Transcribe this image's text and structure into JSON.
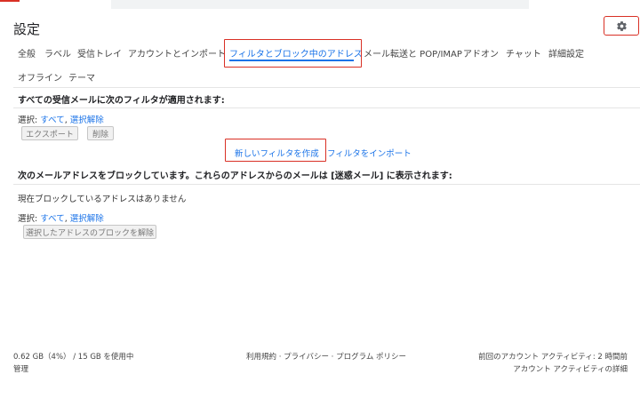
{
  "header": {
    "title": "設定",
    "settings_icon": "gear-icon"
  },
  "tabs": [
    {
      "label": "全般"
    },
    {
      "label": "ラベル"
    },
    {
      "label": "受信トレイ"
    },
    {
      "label": "アカウントとインポート"
    },
    {
      "label": "フィルタとブロック中のアドレス",
      "active": true
    },
    {
      "label": "メール転送と POP/IMAP"
    },
    {
      "label": "アドオン"
    },
    {
      "label": "チャット"
    },
    {
      "label": "詳細設定"
    },
    {
      "label": "オフライン"
    },
    {
      "label": "テーマ"
    }
  ],
  "filters": {
    "heading": "すべての受信メールに次のフィルタが適用されます:",
    "select_label": "選択:",
    "select_all": "すべて",
    "separator": ",",
    "deselect": "選択解除",
    "export_button": "エクスポート",
    "delete_button": "削除",
    "create_filter": "新しいフィルタを作成",
    "import_filters": "フィルタをインポート"
  },
  "blocked": {
    "heading": "次のメールアドレスをブロックしています。これらのアドレスからのメールは [迷惑メール] に表示されます:",
    "empty_text": "現在ブロックしているアドレスはありません",
    "select_label": "選択:",
    "select_all": "すべて",
    "separator": ",",
    "deselect": "選択解除",
    "unblock_button": "選択したアドレスのブロックを解除"
  },
  "footer": {
    "storage": "0.62 GB（4%） / 15 GB を使用中",
    "manage": "管理",
    "terms": "利用規約",
    "privacy": "プライバシー",
    "policy": "プログラム ポリシー",
    "dot": "·",
    "last_activity": "前回のアカウント アクティビティ: 2 時間前",
    "activity_details": "アカウント アクティビティの詳細"
  },
  "colors": {
    "accent": "#1a73e8",
    "highlight": "#d93025"
  }
}
